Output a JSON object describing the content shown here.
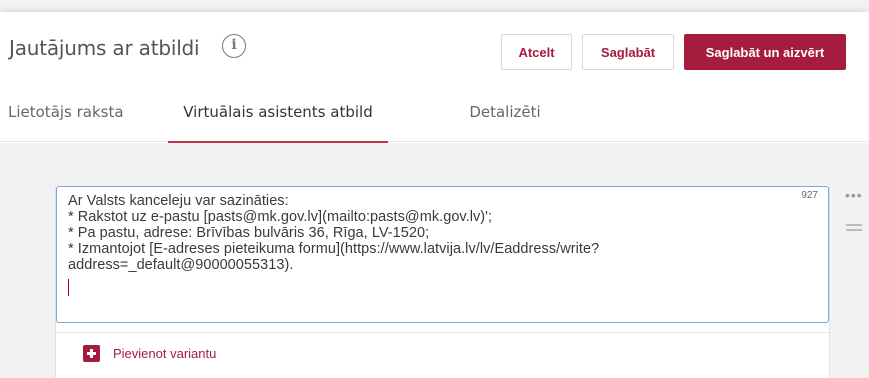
{
  "header": {
    "title": "Jautājums ar atbildi",
    "info_icon": "info-icon",
    "cancel_label": "Atcelt",
    "save_label": "Saglabāt",
    "save_close_label": "Saglabāt un aizvērt"
  },
  "tabs": [
    {
      "label": "Lietotājs raksta"
    },
    {
      "label": "Virtuālais asistents atbild",
      "active": true
    },
    {
      "label": "Detalizēti"
    }
  ],
  "answer": {
    "text": "Ar Valsts kanceleju var sazināties:\n* Rakstot uz e-pastu [pasts@mk.gov.lv](mailto:pasts@mk.gov.lv)';\n* Pa pastu, adrese: Brīvības bulvāris 36, Rīga, LV-1520;\n* Izmantojot [E-adreses pieteikuma formu](https://www.latvija.lv/lv/Eaddress/write?\naddress=_default@90000055313).",
    "char_count": "927"
  },
  "add_variant_label": "Pievienot variantu",
  "colors": {
    "accent": "#a51c3d",
    "tab_underline": "#c0354e",
    "focus_border": "#7aa7d6"
  }
}
